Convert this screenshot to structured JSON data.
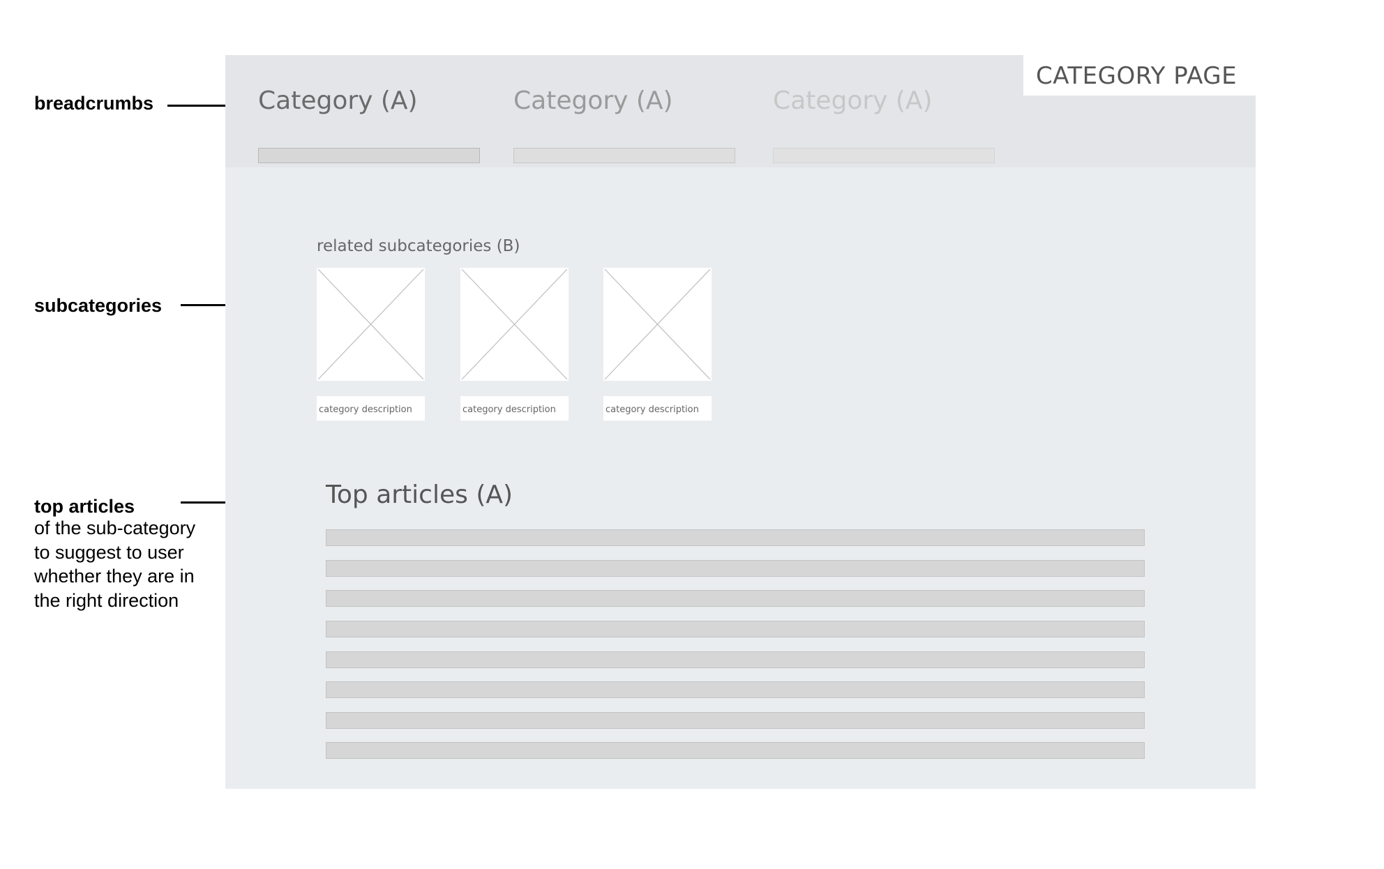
{
  "annotations": {
    "breadcrumbs": "breadcrumbs",
    "subcategories": "subcategories",
    "top_articles": {
      "title": "top articles",
      "description": [
        "of the sub-category",
        "to suggest to user",
        "whether they are in",
        "the right direction"
      ]
    }
  },
  "page_tag": "CATEGORY PAGE",
  "breadcrumbs": [
    {
      "label": "Category (A)",
      "color": "#6a6a6a"
    },
    {
      "label": "Category (A)",
      "color": "#9a9a9a"
    },
    {
      "label": "Category (A)",
      "color": "#c7c7c7"
    }
  ],
  "subcategories": {
    "heading": "related subcategories (B)",
    "items": [
      {
        "description": "category description"
      },
      {
        "description": "category description"
      },
      {
        "description": "category description"
      }
    ]
  },
  "top_articles": {
    "heading": "Top articles (A)",
    "article_count": 8
  },
  "colors": {
    "canvas": "#eaedf0",
    "header_band": "#e4e5e8",
    "placeholder_bar": "#d6d6d6"
  }
}
